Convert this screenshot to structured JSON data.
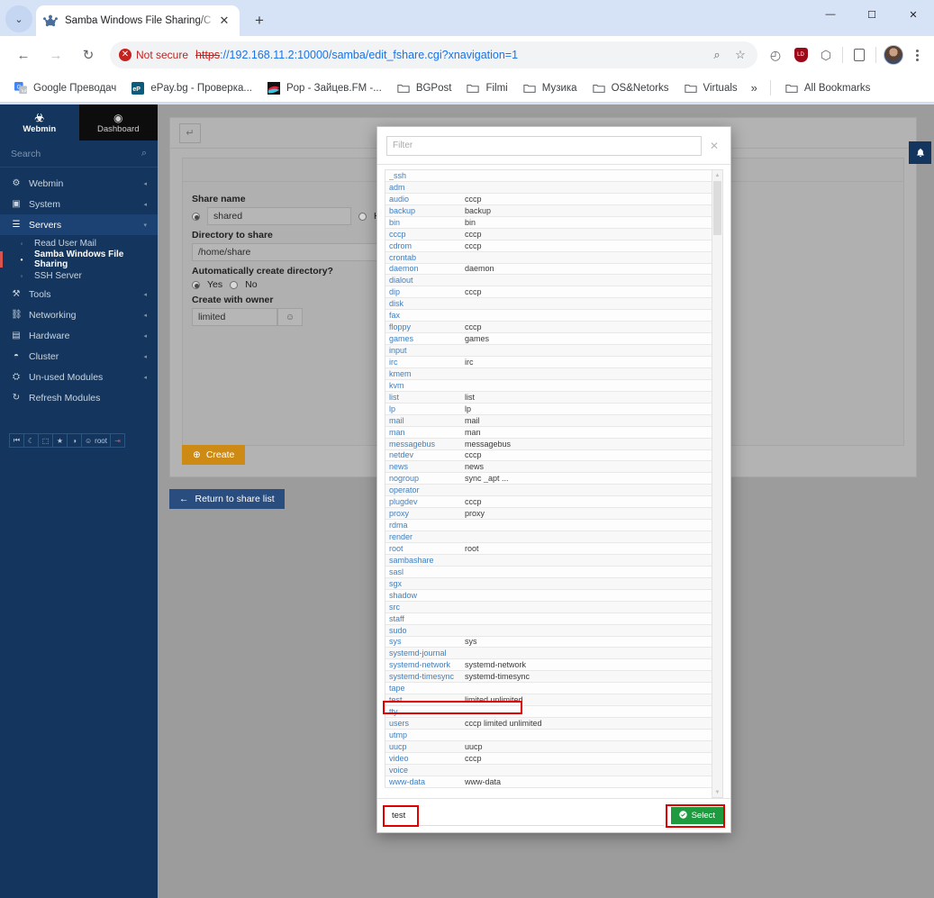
{
  "browser": {
    "tab": {
      "title": "Samba Windows File Sharing/C",
      "favicon": "samba-icon",
      "close": "✕"
    },
    "new_tab": "+",
    "tab_list_chevron": "⌄",
    "window_controls": {
      "minimize": "—",
      "maximize": "☐",
      "close": "✕"
    },
    "nav": {
      "back": "←",
      "forward": "→",
      "reload": "↻"
    },
    "security": {
      "label": "Not secure",
      "icon": "✕"
    },
    "url": {
      "scheme": "https",
      "rest": "://192.168.11.2:10000/samba/edit_fshare.cgi?xnavigation=1"
    },
    "omnibox_icons": [
      {
        "name": "search-icon",
        "glyph": "⌕"
      },
      {
        "name": "bookmark-star-icon",
        "glyph": "☆"
      }
    ],
    "extensions": [
      {
        "name": "history-sync-icon",
        "glyph": "◴"
      },
      {
        "name": "lastpass-icon",
        "glyph": "LD"
      },
      {
        "name": "extensions-puzzle-icon",
        "glyph": "⬡"
      },
      {
        "name": "reading-list-icon",
        "glyph": "☰"
      }
    ],
    "bookmarks": [
      {
        "label": "Google Преводач",
        "icon": "google-translate-icon"
      },
      {
        "label": "ePay.bg - Проверка...",
        "icon": "epay-icon"
      },
      {
        "label": "Pop - Зайцев.FM -...",
        "icon": "zaycev-icon"
      },
      {
        "label": "BGPost",
        "icon": "folder-icon"
      },
      {
        "label": "Filmi",
        "icon": "folder-icon"
      },
      {
        "label": "Музика",
        "icon": "folder-icon"
      },
      {
        "label": "OS&Netorks",
        "icon": "folder-icon"
      },
      {
        "label": "Virtuals",
        "icon": "folder-icon"
      }
    ],
    "bookmarks_overflow": "»",
    "all_bookmarks": {
      "label": "All Bookmarks",
      "icon": "folder-icon"
    }
  },
  "sidebar": {
    "brand": {
      "label": "Webmin",
      "icon": "webmin-logo-icon"
    },
    "dashboard": {
      "label": "Dashboard",
      "icon": "dashboard-icon"
    },
    "search_placeholder": "Search",
    "search_icon": "⌕",
    "items": [
      {
        "label": "Webmin",
        "icon": "⚙",
        "caret": "◂",
        "active": false
      },
      {
        "label": "System",
        "icon": "▣",
        "caret": "◂",
        "active": false
      },
      {
        "label": "Servers",
        "icon": "☰",
        "caret": "▾",
        "active": true
      }
    ],
    "sub_items": [
      {
        "label": "Read User Mail",
        "current": false
      },
      {
        "label": "Samba Windows File Sharing",
        "current": true
      },
      {
        "label": "SSH Server",
        "current": false
      }
    ],
    "items2": [
      {
        "label": "Tools",
        "icon": "⚒",
        "caret": "◂"
      },
      {
        "label": "Networking",
        "icon": "⛓",
        "caret": "◂"
      },
      {
        "label": "Hardware",
        "icon": "▤",
        "caret": "◂"
      },
      {
        "label": "Cluster",
        "icon": "◓",
        "caret": "◂"
      },
      {
        "label": "Un-used Modules",
        "icon": "⛭",
        "caret": "◂"
      },
      {
        "label": "Refresh Modules",
        "icon": "↻",
        "caret": ""
      }
    ],
    "footer_buttons": [
      {
        "name": "collapse-sidebar-button",
        "glyph": "⏮"
      },
      {
        "name": "theme-dark-mode-button",
        "glyph": "☾"
      },
      {
        "name": "screenshot-button",
        "glyph": "⬚"
      },
      {
        "name": "favorites-button",
        "glyph": "★"
      },
      {
        "name": "language-button",
        "glyph": "◑"
      },
      {
        "name": "user-root-button",
        "glyph": "☺",
        "label": "root"
      },
      {
        "name": "logout-button",
        "glyph": "⇥"
      }
    ]
  },
  "page": {
    "back_button_icon": "↵",
    "form": {
      "share_name_label": "Share name",
      "share_name_value": "shared",
      "home_dirs_label": "Home Directories S",
      "directory_label": "Directory to share",
      "directory_value": "/home/share",
      "autocreate_label": "Automatically create directory?",
      "yes_label": "Yes",
      "no_label": "No",
      "owner_label": "Create with owner",
      "owner_value": "limited",
      "owner_picker_icon": "☺"
    },
    "create_button": {
      "label": "Create",
      "icon": "⊕"
    },
    "return_button": {
      "label": "Return to share list",
      "icon": "←"
    },
    "bell_icon": "🔔"
  },
  "modal": {
    "filter_placeholder": "Filter",
    "close_icon": "✕",
    "selected_value": "test",
    "select_button": {
      "label": "Select",
      "icon": "✔"
    },
    "scroll": {
      "up": "▲",
      "down": "▼"
    },
    "highlighted_row": "test",
    "rows": [
      {
        "name": "_ssh",
        "members": ""
      },
      {
        "name": "adm",
        "members": ""
      },
      {
        "name": "audio",
        "members": "cccp"
      },
      {
        "name": "backup",
        "members": "backup"
      },
      {
        "name": "bin",
        "members": "bin"
      },
      {
        "name": "cccp",
        "members": "cccp"
      },
      {
        "name": "cdrom",
        "members": "cccp"
      },
      {
        "name": "crontab",
        "members": ""
      },
      {
        "name": "daemon",
        "members": "daemon"
      },
      {
        "name": "dialout",
        "members": ""
      },
      {
        "name": "dip",
        "members": "cccp"
      },
      {
        "name": "disk",
        "members": ""
      },
      {
        "name": "fax",
        "members": ""
      },
      {
        "name": "floppy",
        "members": "cccp"
      },
      {
        "name": "games",
        "members": "games"
      },
      {
        "name": "input",
        "members": ""
      },
      {
        "name": "irc",
        "members": "irc"
      },
      {
        "name": "kmem",
        "members": ""
      },
      {
        "name": "kvm",
        "members": ""
      },
      {
        "name": "list",
        "members": "list"
      },
      {
        "name": "lp",
        "members": "lp"
      },
      {
        "name": "mail",
        "members": "mail"
      },
      {
        "name": "man",
        "members": "man"
      },
      {
        "name": "messagebus",
        "members": "messagebus"
      },
      {
        "name": "netdev",
        "members": "cccp"
      },
      {
        "name": "news",
        "members": "news"
      },
      {
        "name": "nogroup",
        "members": "sync _apt ..."
      },
      {
        "name": "operator",
        "members": ""
      },
      {
        "name": "plugdev",
        "members": "cccp"
      },
      {
        "name": "proxy",
        "members": "proxy"
      },
      {
        "name": "rdma",
        "members": ""
      },
      {
        "name": "render",
        "members": ""
      },
      {
        "name": "root",
        "members": "root"
      },
      {
        "name": "sambashare",
        "members": ""
      },
      {
        "name": "sasl",
        "members": ""
      },
      {
        "name": "sgx",
        "members": ""
      },
      {
        "name": "shadow",
        "members": ""
      },
      {
        "name": "src",
        "members": ""
      },
      {
        "name": "staff",
        "members": ""
      },
      {
        "name": "sudo",
        "members": ""
      },
      {
        "name": "sys",
        "members": "sys"
      },
      {
        "name": "systemd-journal",
        "members": ""
      },
      {
        "name": "systemd-network",
        "members": "systemd-network"
      },
      {
        "name": "systemd-timesync",
        "members": "systemd-timesync"
      },
      {
        "name": "tape",
        "members": ""
      },
      {
        "name": "test",
        "members": "limited unlimited"
      },
      {
        "name": "tty",
        "members": ""
      },
      {
        "name": "users",
        "members": "cccp limited unlimited"
      },
      {
        "name": "utmp",
        "members": ""
      },
      {
        "name": "uucp",
        "members": "uucp"
      },
      {
        "name": "video",
        "members": "cccp"
      },
      {
        "name": "voice",
        "members": ""
      },
      {
        "name": "www-data",
        "members": "www-data"
      }
    ]
  },
  "colors": {
    "sidebar": "#14365e",
    "accent_orange": "#cd8a14",
    "accent_blue": "#2a4d80",
    "select_green": "#1f9b3f",
    "highlight_red": "#e00000",
    "link_blue": "#3f7fc1"
  }
}
